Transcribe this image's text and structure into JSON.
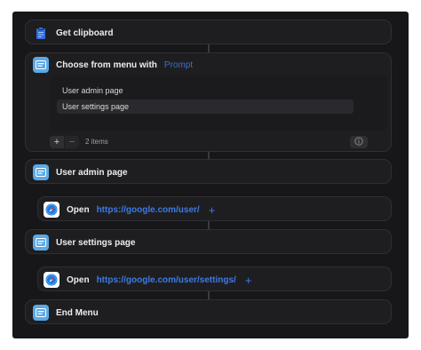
{
  "actions": {
    "get_clipboard": {
      "title": "Get clipboard",
      "icon": "clipboard-icon"
    },
    "choose_menu": {
      "title": "Choose from menu with",
      "param": "Prompt",
      "icon": "menu-icon",
      "items": [
        "User admin page",
        "User settings page"
      ],
      "add_label": "+",
      "remove_label": "−",
      "count_label": "2 items",
      "info_icon": "info-icon"
    },
    "case_admin": {
      "title": "User admin page",
      "icon": "menu-icon"
    },
    "open_admin": {
      "verb": "Open",
      "url": "https://google.com/user/",
      "plus": "+",
      "icon": "safari-icon"
    },
    "case_settings": {
      "title": "User settings page",
      "icon": "menu-icon"
    },
    "open_settings": {
      "verb": "Open",
      "url": "https://google.com/user/settings/",
      "plus": "+",
      "icon": "safari-icon"
    },
    "end_menu": {
      "title": "End Menu",
      "icon": "menu-icon"
    }
  },
  "colors": {
    "background": "#17171a",
    "card": "#1e1e21",
    "accent_blue": "#3d7ae6",
    "menu_icon": "#5aa9e6"
  }
}
